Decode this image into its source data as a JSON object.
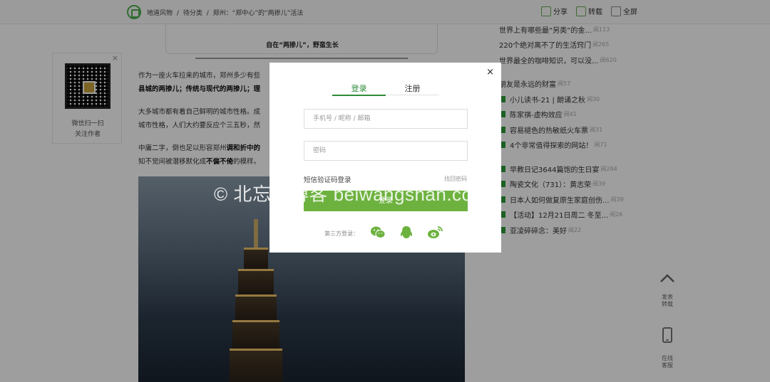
{
  "topbar": {
    "breadcrumb": [
      "地道风物",
      "/",
      "待分类",
      "/",
      "郑州：“郑中心”的“两掺儿”活法"
    ],
    "actions": [
      {
        "label": "分享",
        "icon": "share-icon"
      },
      {
        "label": "转载",
        "icon": "repost-icon"
      },
      {
        "label": "全屏",
        "icon": "fullscreen-icon"
      }
    ]
  },
  "qr_card": {
    "close": "×",
    "line1": "微信扫一扫",
    "line2": "关注作者"
  },
  "article": {
    "caption": "自在“两掺儿”，野蛮生长",
    "p1_line1": "作为一座火车拉来的城市，郑州多少有些",
    "p1_line2_bold": "县城的两掺儿；传统与现代的两掺儿；理",
    "p2_line1": "大多城市都有着自己鲜明的城市性格。成",
    "p2_line2": "城市性格，人们大约要反应个三五秒，然",
    "p3_line1_pre": "中庸二字，倒也足以形容郑州",
    "p3_line1_bold": "调和折中的",
    "p3_line2_pre": "知不觉间被潜移默化成",
    "p3_line2_bold": "不偏不倚",
    "p3_line2_post": "的模样。"
  },
  "sidebar": {
    "top_items": [
      {
        "title": "世界上有哪些最“另类”的金...",
        "count": "阅113"
      },
      {
        "title": "220个绝对离不了的生活窍门",
        "count": "阅265"
      },
      {
        "title": "世界最全的咖啡知识，可以没...",
        "count": "阅620"
      },
      {
        "title": "朋友是永远的财富",
        "count": "阅57"
      }
    ],
    "items": [
      {
        "title": "小儿读书-21 | 朗诵之秋",
        "count": "阅30"
      },
      {
        "title": "陈家祺-虚构效应",
        "count": "阅41"
      },
      {
        "title": "容易褪色的热敏纸火车票",
        "count": "阅31"
      },
      {
        "title": "4个非常值得探索的网站！",
        "count": "阅71"
      },
      {
        "title": "早教日记3644篇饱的生日宴",
        "count": "阅284"
      },
      {
        "title": "陶瓷文化（731）：黄志荣",
        "count": "阅39"
      },
      {
        "title": "日本人如何做复原生家庭创伤...",
        "count": "阅39"
      },
      {
        "title": "【活动】12月21日周二 冬至...",
        "count": "阅26"
      },
      {
        "title": "亚凌碎碎念：美好",
        "count": "阅22"
      }
    ],
    "float_buttons": [
      {
        "label1": "发表",
        "label2": "转载"
      },
      {
        "label1": "在线",
        "label2": "客服"
      }
    ]
  },
  "watermark": "© 北忘山博客 beiwangshan.com",
  "login_modal": {
    "close": "×",
    "tabs": [
      "登录",
      "注册"
    ],
    "active_tab": "登录",
    "account_placeholder": "手机号 / 昵称 / 邮箱",
    "password_placeholder": "密码",
    "sms_login": "短信验证码登录",
    "forgot_password": "找回密码",
    "submit": "登录",
    "third_party_label": "第三方登录：",
    "social": [
      "wechat-icon",
      "qq-icon",
      "weibo-icon"
    ],
    "accent_color": "#6db23f"
  }
}
